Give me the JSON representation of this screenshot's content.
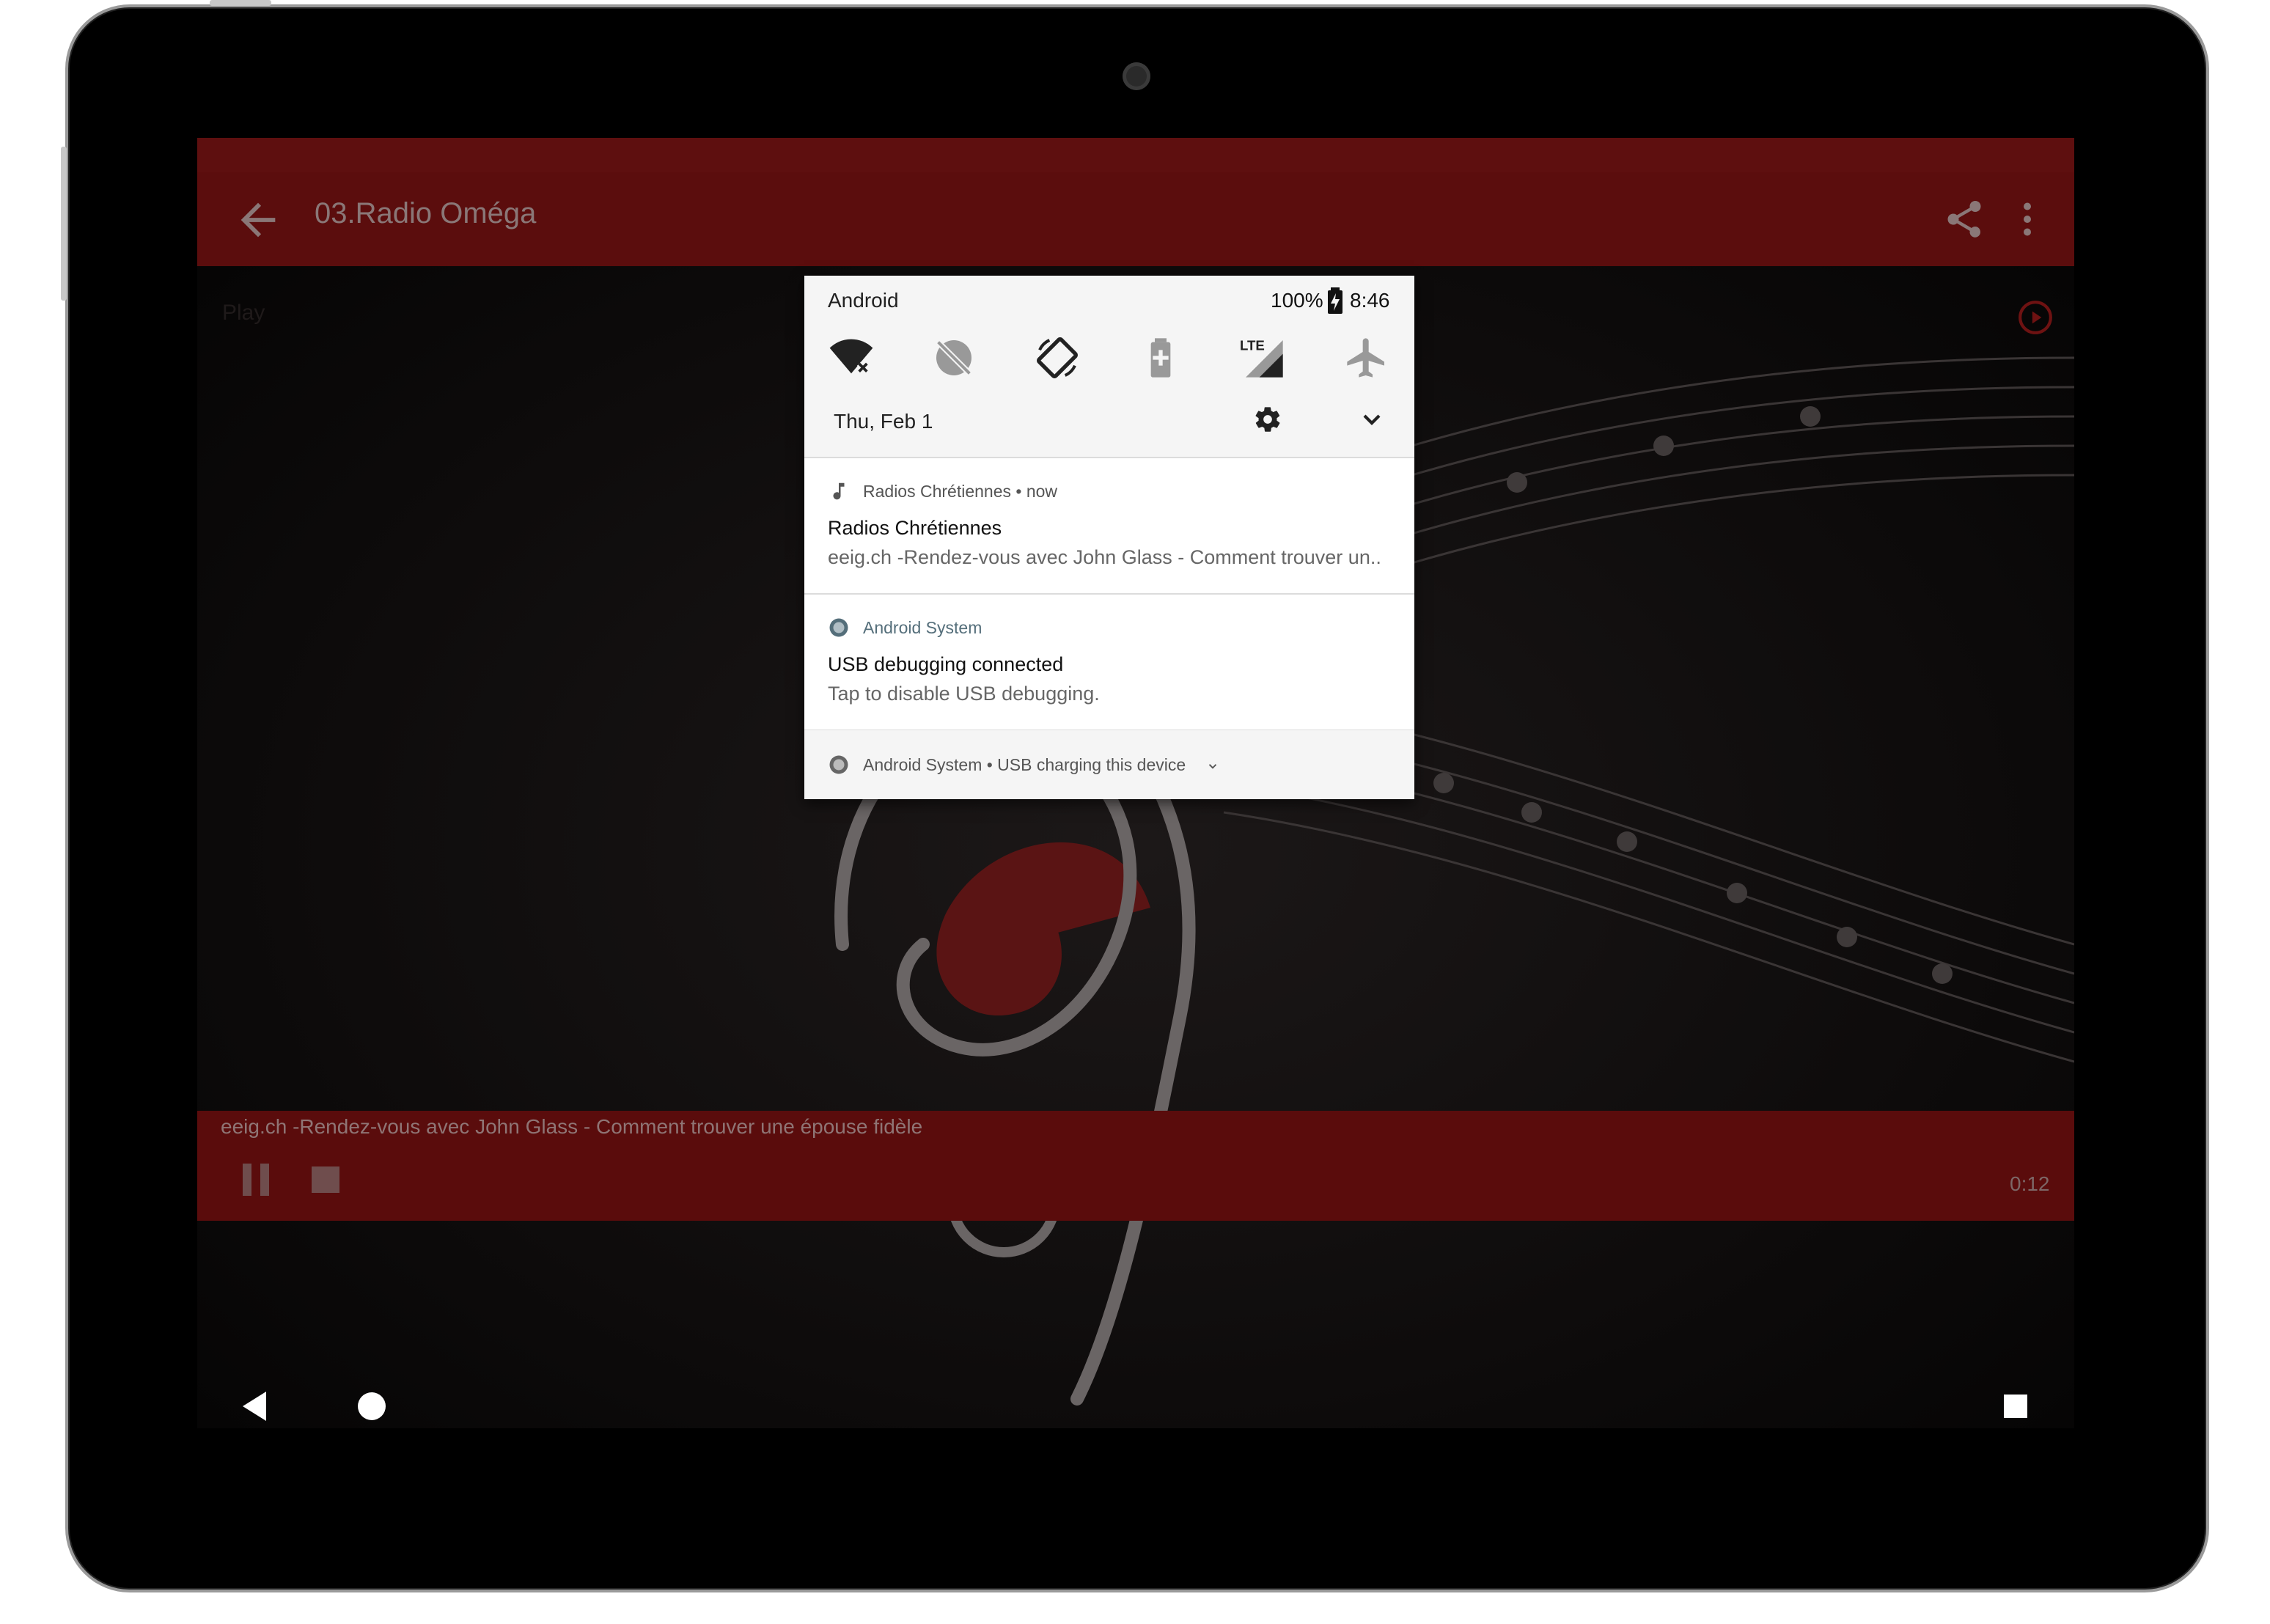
{
  "app": {
    "title": "03.Radio Oméga",
    "play_label": "Play",
    "now_playing": "eeig.ch -Rendez-vous avec John Glass - Comment trouver une épouse fidèle",
    "elapsed": "0:12"
  },
  "shade": {
    "carrier": "Android",
    "battery_percent": "100%",
    "time": "8:46",
    "date": "Thu, Feb 1",
    "tiles": [
      "wifi-off-icon",
      "do-not-disturb-icon",
      "auto-rotate-icon",
      "battery-saver-icon",
      "lte-signal-icon",
      "airplane-mode-icon"
    ],
    "lte_label": "LTE",
    "notifications": [
      {
        "app": "Radios Chrétiennes • now",
        "title": "Radios Chrétiennes",
        "text": "eeig.ch -Rendez-vous avec John Glass - Comment trouver un.."
      },
      {
        "app": "Android System",
        "title": "USB debugging connected",
        "text": "Tap to disable USB debugging."
      }
    ],
    "footer": "Android System • USB charging this device"
  },
  "colors": {
    "appbar": "#5b0d0d",
    "shade_bg": "#f5f5f5",
    "accent": "#8b1a1a"
  }
}
